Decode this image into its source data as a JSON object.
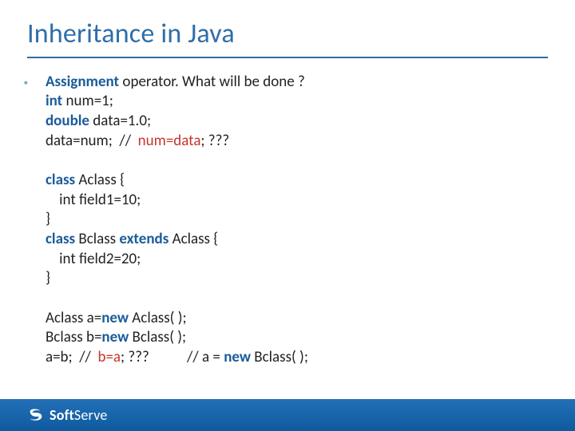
{
  "title": "Inheritance in Java",
  "footer": {
    "brand_left": "Soft",
    "brand_right": "Serve"
  },
  "content": {
    "intro_bold": "Assignment",
    "intro_rest": " operator. What will be done ?",
    "l1_kw": "int",
    "l1_rest": " num=1;",
    "l2_kw": "double",
    "l2_rest": " data=1.0;",
    "l3_pre": "data=num;  //  ",
    "l3_red": "num=data",
    "l3_post": "; ???",
    "blank1": " ",
    "l4_kw": "class",
    "l4_rest": " Aclass {",
    "l5": "    int field1=10;",
    "l6": "}",
    "l7_kw1": "class",
    "l7_mid": " Bclass ",
    "l7_kw2": "extends",
    "l7_rest": " Aclass {",
    "l8": "    int field2=20;",
    "l9": "}",
    "blank2": " ",
    "l10_pre": "Aclass a=",
    "l10_kw": "new",
    "l10_post": " Aclass( );",
    "l11_pre": "Bclass b=",
    "l11_kw": "new",
    "l11_post": " Bclass( );",
    "l12_pre": "a=b;  //  ",
    "l12_red": "b=a",
    "l12_mid": "; ???           // a = ",
    "l12_kw": "new",
    "l12_post": " Bclass( );"
  }
}
